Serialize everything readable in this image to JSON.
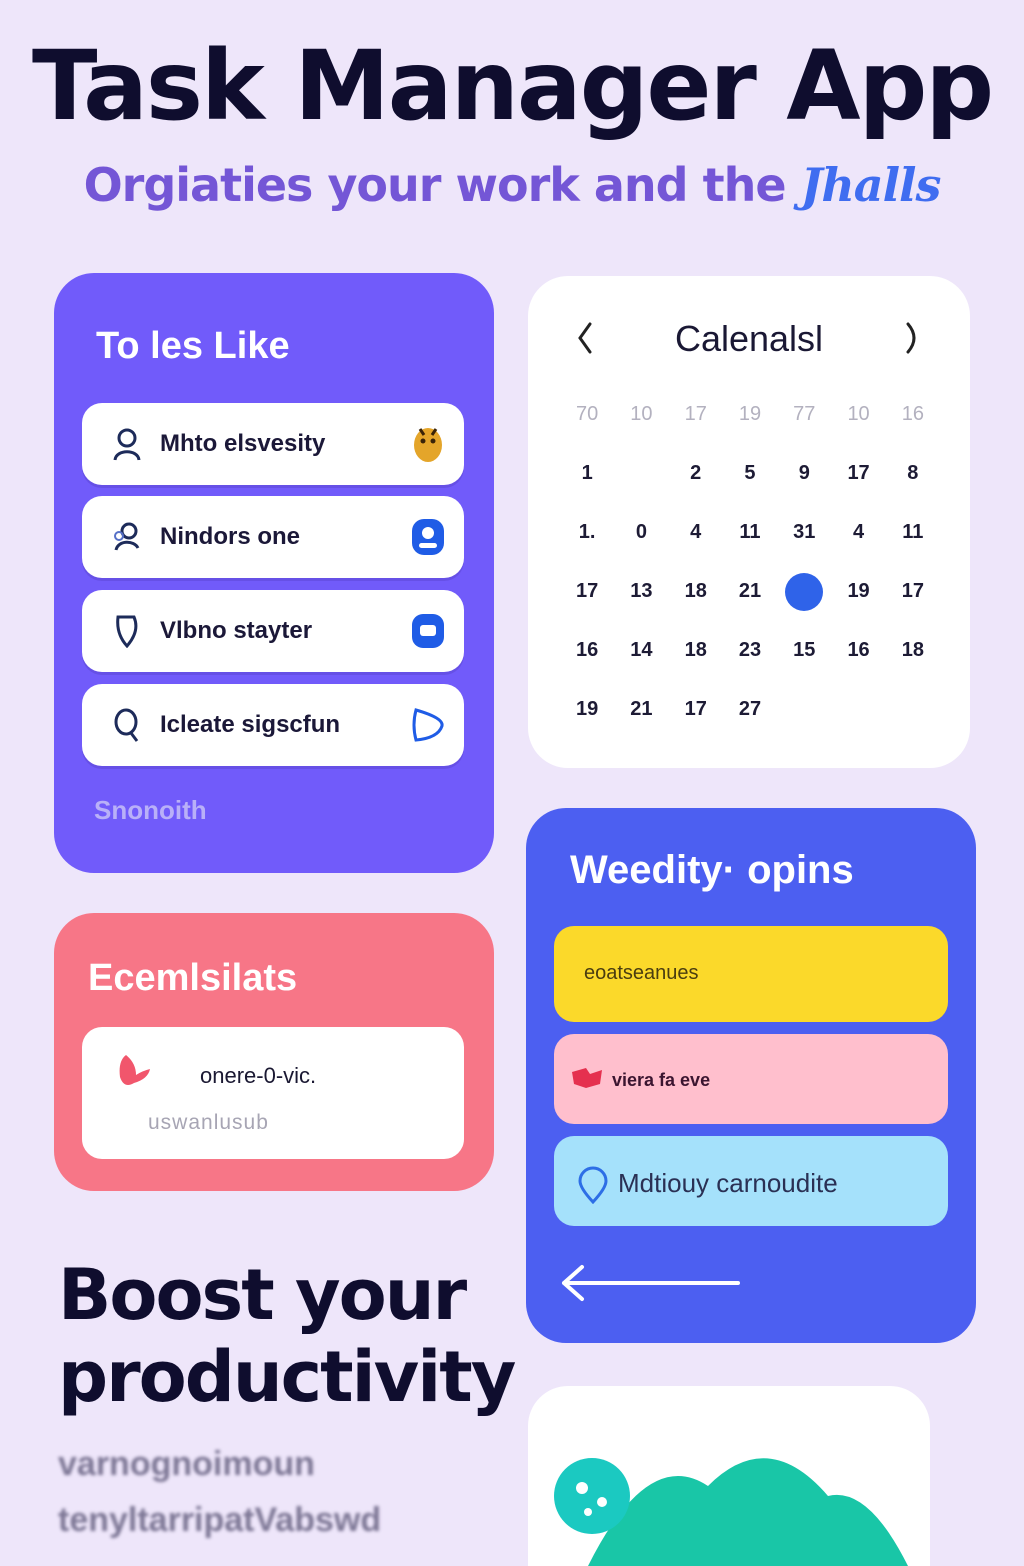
{
  "header": {
    "title": "Task Manager App",
    "subtitle_main": "Orgiaties your work and the",
    "subtitle_accent": "Jhalls"
  },
  "todo": {
    "title": "To les Like",
    "items": [
      {
        "label": "Mhto elsvesity",
        "icon": "user-icon",
        "trail_icon": "mascot-icon"
      },
      {
        "label": "Nindors one",
        "icon": "users-icon",
        "trail_icon": "profile-badge-icon"
      },
      {
        "label": "Vlbno stayter",
        "icon": "shield-icon",
        "trail_icon": "chat-badge-icon"
      },
      {
        "label": "Icleate sigscfun",
        "icon": "search-icon",
        "trail_icon": "play-icon"
      }
    ],
    "footer": "Snonoith"
  },
  "calendar": {
    "title": "Calenalsl",
    "prev_icon": "chevron-left-icon",
    "next_icon": "chevron-right-icon",
    "header_row": [
      "70",
      "10",
      "17",
      "19",
      "77",
      "10",
      "16"
    ],
    "rows": [
      [
        "1",
        "",
        "2",
        "5",
        "9",
        "17",
        "8"
      ],
      [
        "1.",
        "0",
        "4",
        "11",
        "31",
        "4",
        "11"
      ],
      [
        "17",
        "13",
        "18",
        "21",
        "●",
        "19",
        "17"
      ],
      [
        "16",
        "14",
        "18",
        "23",
        "15",
        "16",
        "18"
      ],
      [
        "19",
        "21",
        "17",
        "27",
        "",
        "",
        ""
      ]
    ],
    "selected": {
      "row": 2,
      "col": 4
    }
  },
  "email": {
    "title": "Ecemlsilats",
    "line1": "onere-0-vic.",
    "line2": "uswanlusub",
    "icon": "heart-icon",
    "accent": "#f77687"
  },
  "weekly": {
    "title": "Weedity· opins",
    "items": [
      {
        "label": "eoatseanues",
        "color": "#fbd92a"
      },
      {
        "label": "viera fa eve",
        "color": "#ffbfcd",
        "icon": "flag-icon"
      },
      {
        "label": "Mdtiouy carnoudite",
        "color": "#a5e1fb",
        "icon": "location-pin-icon"
      }
    ],
    "arrow_icon": "arrow-left-icon"
  },
  "boost": {
    "line1": "Boost your",
    "line2": "productivity",
    "sub1": "varnognoimoun",
    "sub2": "tenyltarripatVabswd"
  },
  "colors": {
    "background": "#eee6fa",
    "todo_card": "#715bfa",
    "weekly_card": "#4c5ff1",
    "calendar_selected": "#2f63e9",
    "subtitle": "#7456d6"
  }
}
